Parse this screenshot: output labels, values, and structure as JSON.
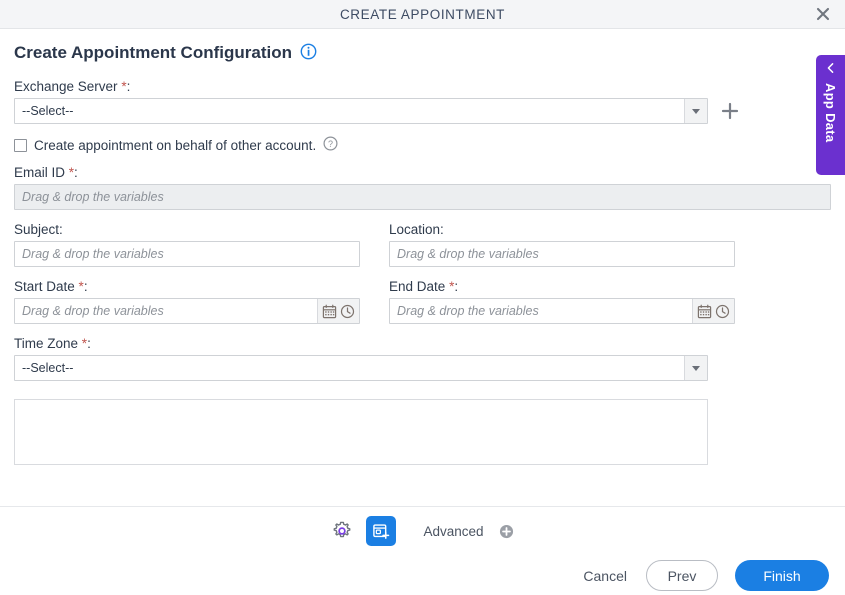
{
  "window": {
    "title": "CREATE APPOINTMENT",
    "close_icon": "close-icon"
  },
  "page": {
    "heading": "Create Appointment Configuration",
    "info_icon": "info-icon"
  },
  "form": {
    "exchange_server": {
      "label": "Exchange Server",
      "required_mark": "*",
      "colon": ":",
      "value": "--Select--",
      "add_icon": "plus-icon"
    },
    "on_behalf": {
      "label": "Create appointment on behalf of other account.",
      "checked": false,
      "help_icon": "question-mark-icon"
    },
    "email_id": {
      "label": "Email ID",
      "required_mark": "*",
      "colon": ":",
      "value": "",
      "placeholder": "Drag & drop the variables",
      "disabled": true
    },
    "subject": {
      "label": "Subject",
      "colon": ":",
      "value": "",
      "placeholder": "Drag & drop the variables"
    },
    "location": {
      "label": "Location",
      "colon": ":",
      "value": "",
      "placeholder": "Drag & drop the variables"
    },
    "start_date": {
      "label": "Start Date",
      "required_mark": "*",
      "colon": ":",
      "value": "",
      "placeholder": "Drag & drop the variables",
      "calendar_icon": "calendar-icon",
      "clock_icon": "clock-icon"
    },
    "end_date": {
      "label": "End Date",
      "required_mark": "*",
      "colon": ":",
      "value": "",
      "placeholder": "Drag & drop the variables",
      "calendar_icon": "calendar-icon",
      "clock_icon": "clock-icon"
    },
    "time_zone": {
      "label": "Time Zone",
      "required_mark": "*",
      "colon": ":",
      "value": "--Select--"
    },
    "notes": {
      "value": "",
      "placeholder": ""
    }
  },
  "toolbar": {
    "settings_icon": "gear-icon",
    "appointment_icon": "calendar-plus-icon",
    "advanced_label": "Advanced",
    "advanced_add_icon": "plus-circle-icon"
  },
  "actions": {
    "cancel_label": "Cancel",
    "prev_label": "Prev",
    "finish_label": "Finish"
  },
  "side_panel": {
    "label": "App Data",
    "collapse_icon": "chevron-left-icon"
  },
  "colors": {
    "accent_blue": "#1b7fe3",
    "purple": "#6b30cf",
    "required_red": "#c0554e",
    "titlebar_bg": "#f4f5f7"
  }
}
